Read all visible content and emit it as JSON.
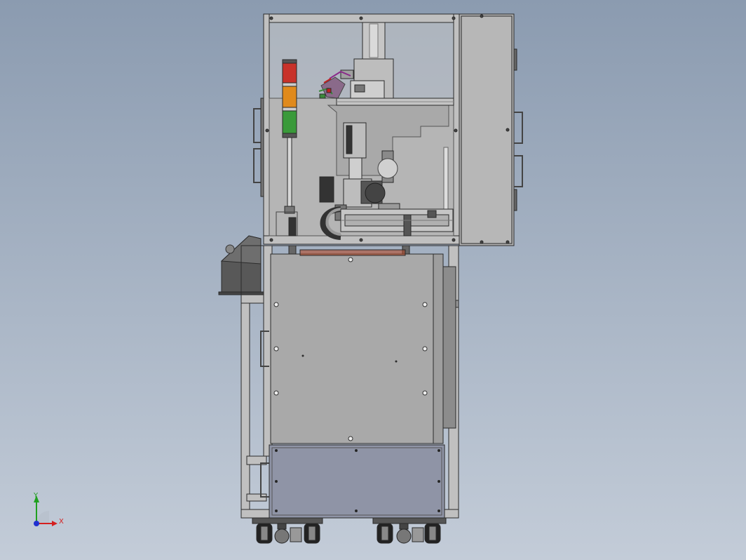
{
  "view": {
    "background_top": "#8b9bb0",
    "background_bottom": "#c3ccd8"
  },
  "colors": {
    "sheet_metal": "#b4b4b4",
    "frame_edge": "#2a2a2a",
    "frame_fill": "#c8c8c8",
    "door_panel": "#a9a9a9",
    "base_panel": "#8f94a6",
    "lamp_red": "#c8322a",
    "lamp_amber": "#e08a1c",
    "lamp_green": "#3a9a3a"
  },
  "triad": {
    "x_label": "X",
    "y_label": "Y",
    "x_color": "#d42020",
    "y_color": "#20a020",
    "z_color": "#2030d0"
  }
}
